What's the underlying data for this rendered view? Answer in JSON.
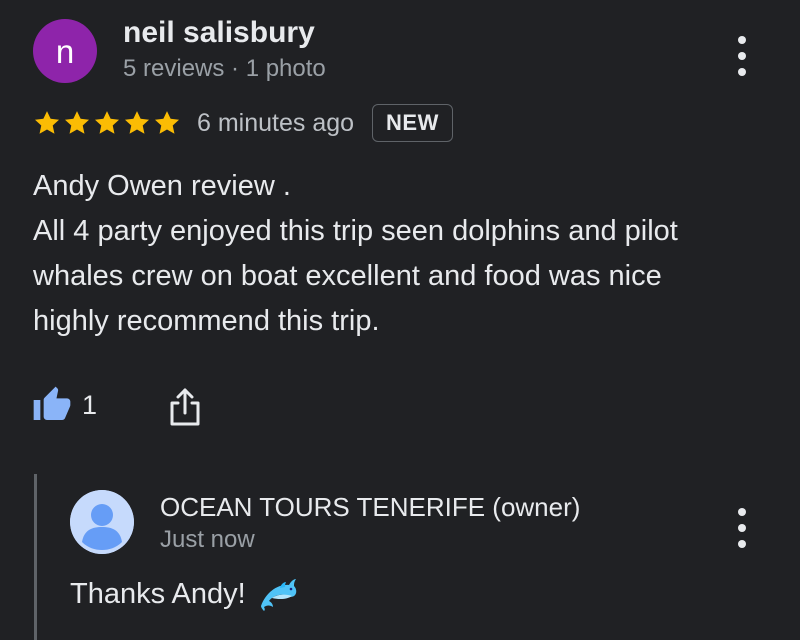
{
  "review": {
    "avatar_letter": "n",
    "avatar_color": "#8e24aa",
    "author": "neil salisbury",
    "author_meta": "5 reviews · 1 photo",
    "rating": 5,
    "rating_max": 5,
    "star_color": "#fbbc04",
    "time": "6 minutes ago",
    "badge": "NEW",
    "body_lines": [
      "Andy Owen review .",
      "All 4 party enjoyed this trip seen dolphins and pilot",
      "whales crew on boat excellent and food was nice",
      "highly recommend this trip."
    ],
    "like_count": "1",
    "like_color": "#8ab4f8",
    "menu_icon": "more-vert-icon",
    "share_icon": "share-icon"
  },
  "owner_reply": {
    "avatar_icon": "person-icon",
    "name": "OCEAN TOURS TENERIFE (owner)",
    "time": "Just now",
    "text": "Thanks Andy!",
    "emoji_icon": "dolphin-icon",
    "menu_icon": "more-vert-icon"
  }
}
